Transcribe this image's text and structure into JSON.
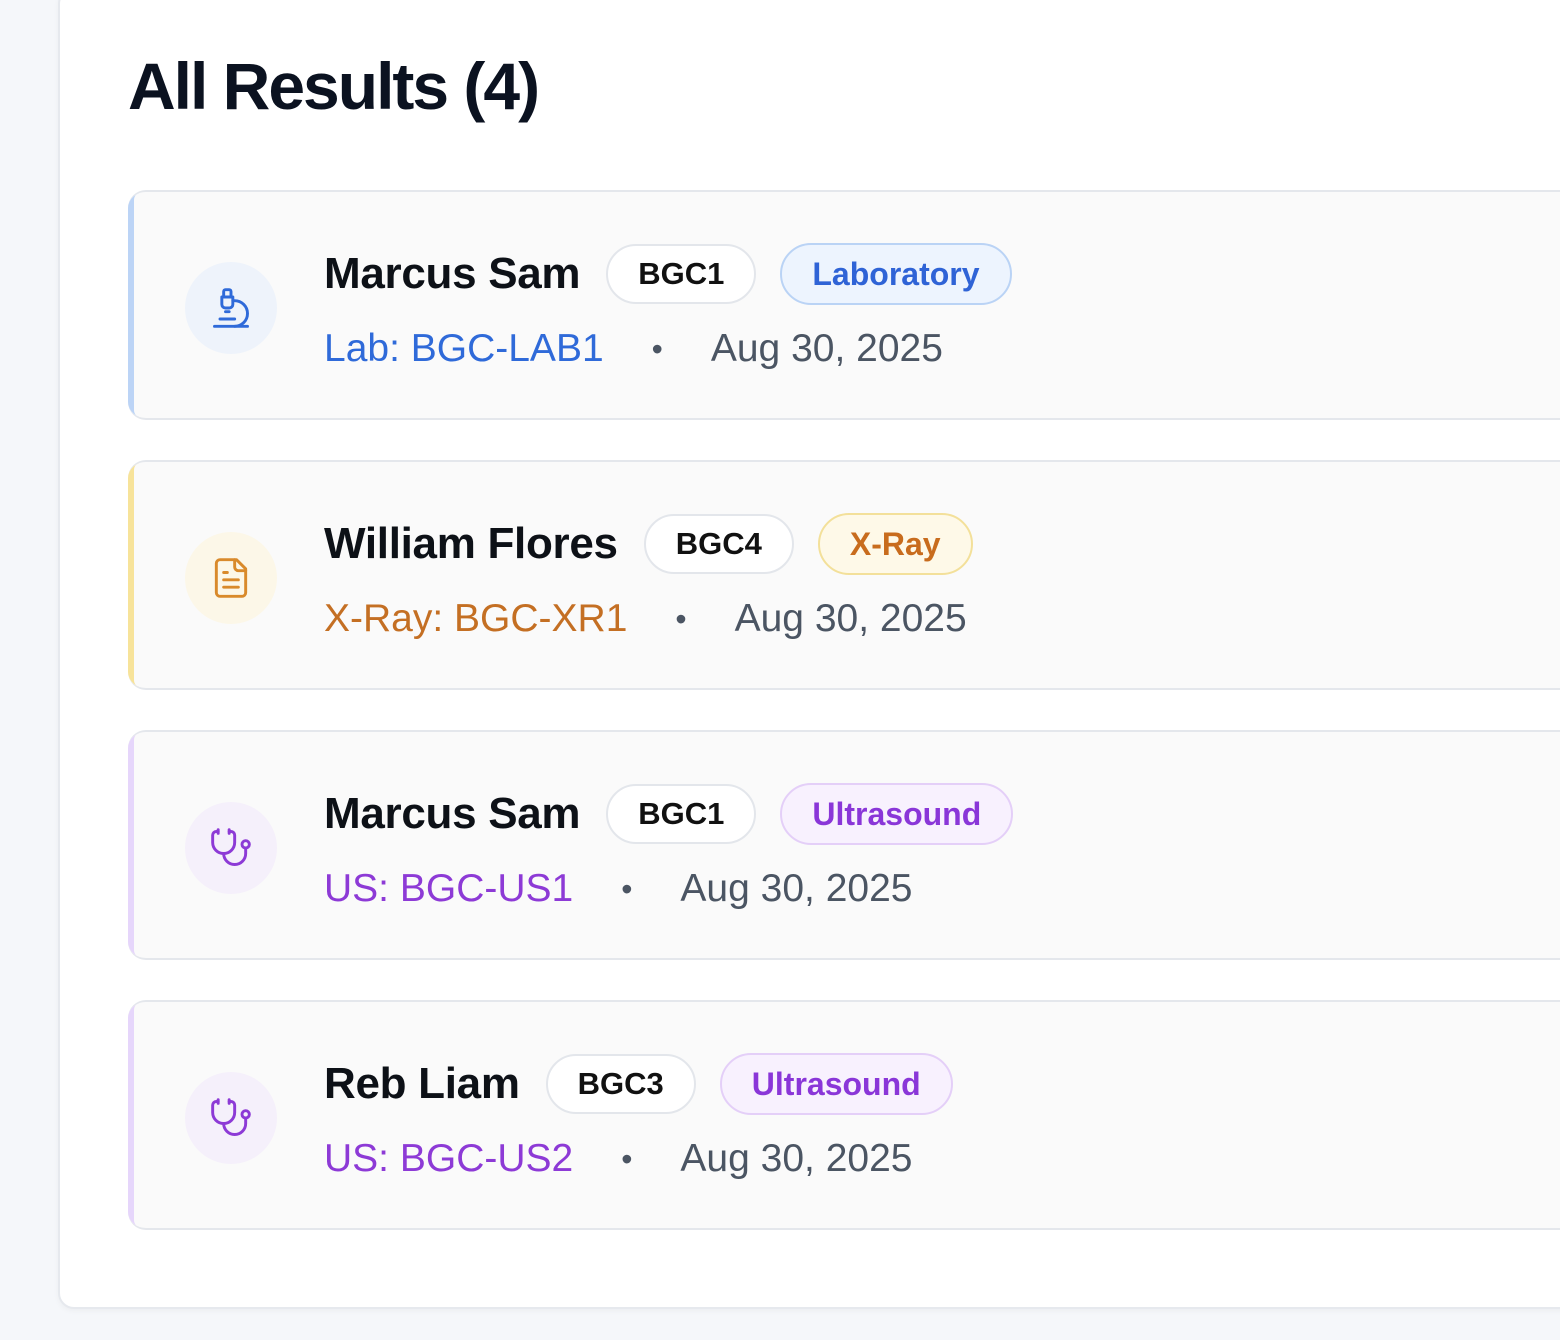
{
  "header": {
    "title": "All Results (4)"
  },
  "results": [
    {
      "name": "Marcus Sam",
      "code": "BGC1",
      "type": "Laboratory",
      "reference": "Lab: BGC-LAB1",
      "separator": "•",
      "date": "Aug 30, 2025",
      "icon": "microscope-icon"
    },
    {
      "name": "William Flores",
      "code": "BGC4",
      "type": "X-Ray",
      "reference": "X-Ray: BGC-XR1",
      "separator": "•",
      "date": "Aug 30, 2025",
      "icon": "document-icon"
    },
    {
      "name": "Marcus Sam",
      "code": "BGC1",
      "type": "Ultrasound",
      "reference": "US: BGC-US1",
      "separator": "•",
      "date": "Aug 30, 2025",
      "icon": "stethoscope-icon"
    },
    {
      "name": "Reb Liam",
      "code": "BGC3",
      "type": "Ultrasound",
      "reference": "US: BGC-US2",
      "separator": "•",
      "date": "Aug 30, 2025",
      "icon": "stethoscope-icon"
    }
  ],
  "colors": {
    "laboratory": "#2f6ad9",
    "xray": "#c46f23",
    "ultrasound": "#8d3ad6"
  }
}
